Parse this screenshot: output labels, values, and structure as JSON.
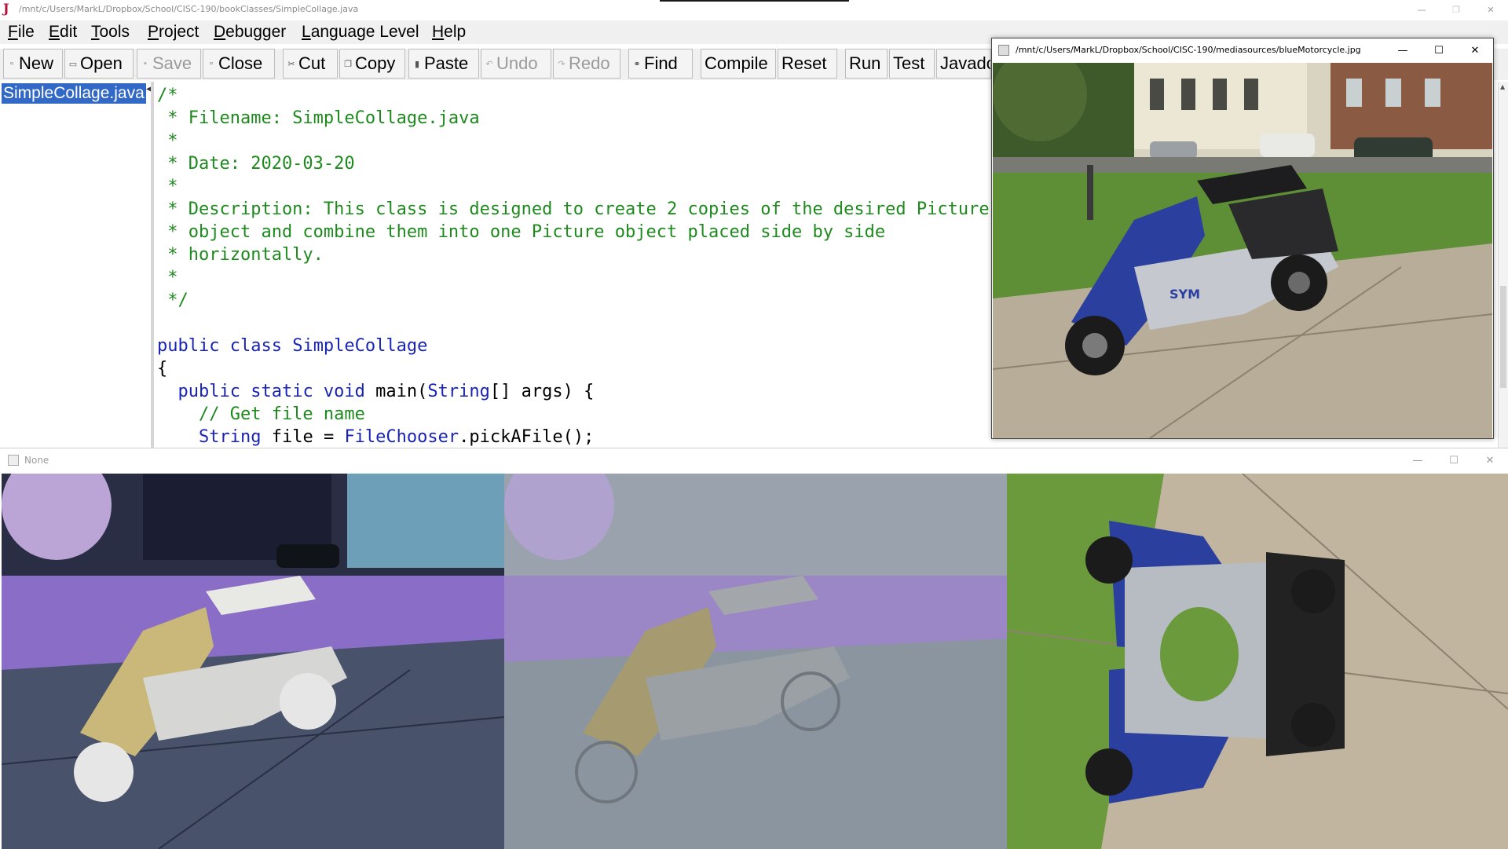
{
  "ide": {
    "title": "/mnt/c/Users/MarkL/Dropbox/School/CISC-190/bookClasses/SimpleCollage.java",
    "window_controls": {
      "minimize": "—",
      "maximize": "❐",
      "close": "✕"
    },
    "menu": [
      {
        "label": "File",
        "underline": "F",
        "rest": "ile"
      },
      {
        "label": "Edit",
        "underline": "E",
        "rest": "dit"
      },
      {
        "label": "Tools",
        "underline": "T",
        "rest": "ools"
      },
      {
        "label": "Project",
        "underline": "P",
        "rest": "roject"
      },
      {
        "label": "Debugger",
        "underline": "D",
        "rest": "ebugger"
      },
      {
        "label": "Language Level",
        "underline": "L",
        "rest": "anguage Level"
      },
      {
        "label": "Help",
        "underline": "H",
        "rest": "elp"
      }
    ],
    "toolbar": {
      "new": "New",
      "open": "Open",
      "save": "Save",
      "close": "Close",
      "cut": "Cut",
      "copy": "Copy",
      "paste": "Paste",
      "undo": "Undo",
      "redo": "Redo",
      "find": "Find",
      "compile": "Compile",
      "reset": "Reset",
      "run": "Run",
      "test": "Test",
      "javadoc": "Javadoc"
    },
    "files": [
      "SimpleCollage.java"
    ],
    "code": {
      "l1": "/*",
      "l2": " * Filename: SimpleCollage.java",
      "l3": " *",
      "l4": " * Date: 2020-03-20",
      "l5": " *",
      "l6": " * Description: This class is designed to create 2 copies of the desired Picture",
      "l7": " * object and combine them into one Picture object placed side by side",
      "l8": " * horizontally.",
      "l9": " *",
      "l10": " */",
      "l12_kw": "public class",
      "l12_rest": " SimpleCollage",
      "l13": "{",
      "l14_indent": "  ",
      "l14_kw": "public static void",
      "l14_rest": " main(",
      "l14_type": "String",
      "l14_end": "[] args) {",
      "l15": "    // Get file name",
      "l16_indent": "    ",
      "l16_type": "String",
      "l16_mid": " file = ",
      "l16_type2": "FileChooser",
      "l16_end": ".pickAFile();"
    }
  },
  "viewer": {
    "title": "/mnt/c/Users/MarkL/Dropbox/School/CISC-190/mediasources/blueMotorcycle.jpg",
    "controls": {
      "minimize": "—",
      "maximize": "☐",
      "close": "✕"
    },
    "photo_brand": "SYM"
  },
  "collage": {
    "title": "None",
    "controls": {
      "minimize": "—",
      "maximize": "☐",
      "close": "✕"
    },
    "panels": [
      "negated copy",
      "edge-detected copy",
      "mirrored copy"
    ]
  },
  "colors": {
    "comment": "#1e8a1e",
    "keyword": "#1a23b8",
    "selection": "#3369c6",
    "scooter_blue": "#2b3f9e"
  }
}
